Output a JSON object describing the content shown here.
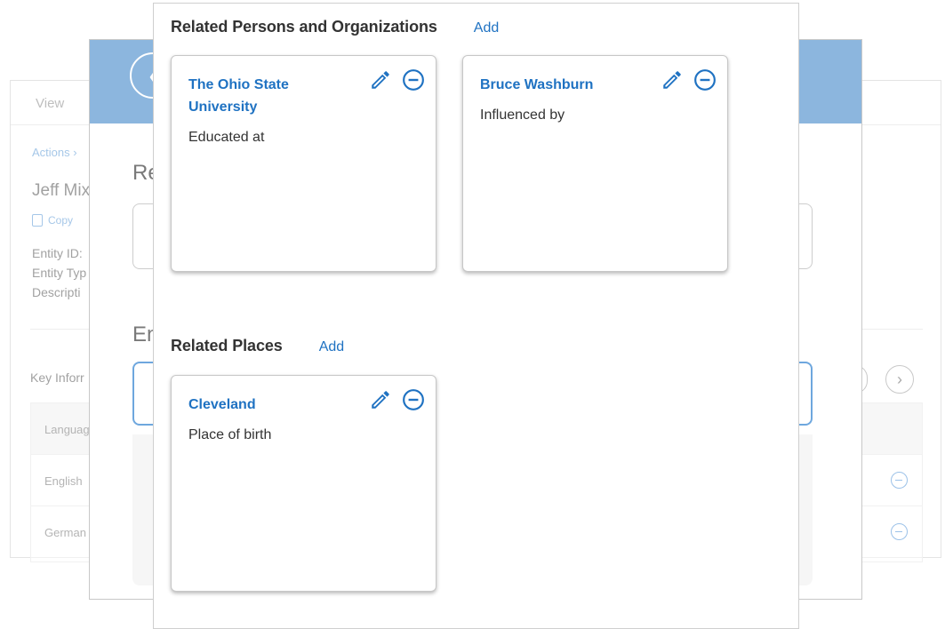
{
  "back_page": {
    "tab_view": "View",
    "actions": "Actions",
    "title": "Jeff Mix",
    "copy": "Copy",
    "entity_id_label": "Entity ID:",
    "entity_type_label": "Entity Typ",
    "description_label": "Descripti",
    "key_info": "Key Inforr",
    "table_header": "Languag",
    "rows": [
      "English",
      "German"
    ]
  },
  "mid_modal": {
    "heading_1": "Re",
    "heading_2": "En"
  },
  "relations": {
    "persons_section": {
      "title": "Related Persons and Organizations",
      "add_label": "Add",
      "cards": [
        {
          "name": "The Ohio State University",
          "role": "Educated at"
        },
        {
          "name": "Bruce Washburn",
          "role": "Influenced by"
        }
      ]
    },
    "places_section": {
      "title": "Related Places",
      "add_label": "Add",
      "cards": [
        {
          "name": "Cleveland",
          "role": "Place of birth"
        }
      ]
    }
  },
  "icons": {
    "edit": "pencil-icon",
    "remove": "minus-circle-icon",
    "accent_color": "#1f72c2"
  }
}
